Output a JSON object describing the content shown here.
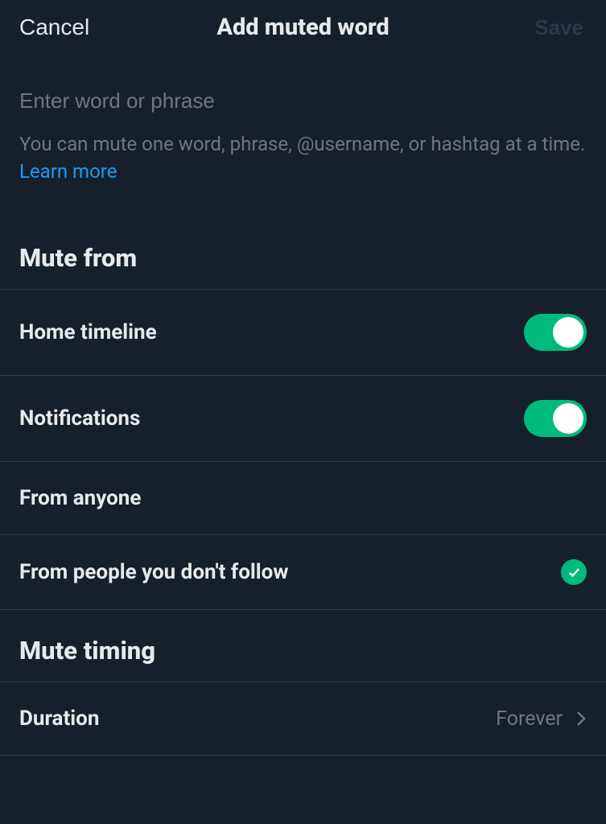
{
  "header": {
    "cancel_label": "Cancel",
    "title": "Add muted word",
    "save_label": "Save"
  },
  "input": {
    "placeholder": "Enter word or phrase",
    "hint_prefix": "You can mute one word, phrase, @username, or hashtag at a time. ",
    "learn_more": "Learn more"
  },
  "sections": {
    "mute_from": {
      "title": "Mute from",
      "home_timeline": "Home timeline",
      "notifications": "Notifications",
      "from_anyone": "From anyone",
      "from_not_follow": "From people you don't follow"
    },
    "mute_timing": {
      "title": "Mute timing",
      "duration_label": "Duration",
      "duration_value": "Forever"
    }
  }
}
